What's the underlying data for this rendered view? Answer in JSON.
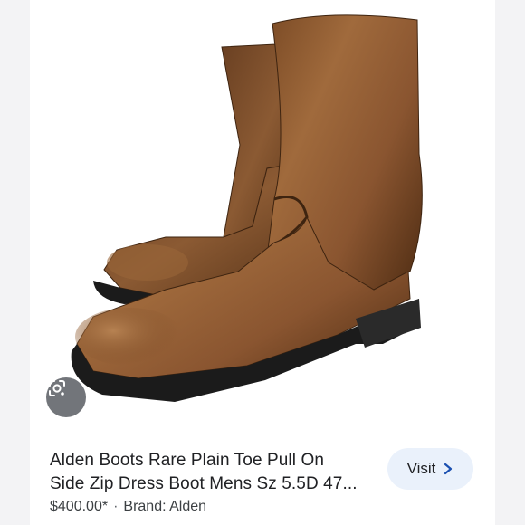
{
  "product": {
    "title_line1": "Alden Boots Rare Plain Toe Pull On",
    "title_line2": "Side Zip Dress Boot Mens Sz 5.5D 47...",
    "price": "$400.00*",
    "separator": "·",
    "brand": "Brand: Alden",
    "image_alt": "Brown leather side zip pull on boots"
  },
  "actions": {
    "visit_label": "Visit",
    "visit_icon": "chevron-right-icon",
    "lens_icon": "google-lens-icon"
  },
  "colors": {
    "visit_bg": "#eaf1fb",
    "text": "#202124",
    "boot_leather": "#8a5730",
    "sole": "#1b1b1b"
  }
}
